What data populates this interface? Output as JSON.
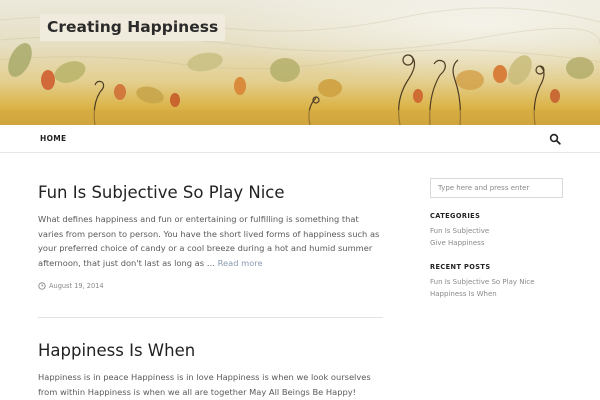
{
  "header": {
    "site_title": "Creating Happiness"
  },
  "nav": {
    "home_label": "HOME",
    "search_icon": "search-icon"
  },
  "posts": [
    {
      "title": "Fun Is Subjective So Play Nice",
      "excerpt": "What defines happiness and fun or entertaining or fulfilling is something that varies from person to person.  You have the short lived forms of happiness such as your preferred choice of candy or a cool breeze during a hot and humid summer afternoon, that just don't last as long as …",
      "read_more": "Read more",
      "date": "August 19, 2014",
      "date_icon": "clock-icon"
    },
    {
      "title": "Happiness Is When",
      "excerpt": "Happiness is in peace Happiness is in love Happiness is when we look ourselves from within Happiness is when we all are together May All Beings Be Happy!"
    }
  ],
  "sidebar": {
    "search_placeholder": "Type here and press enter",
    "categories_title": "CATEGORIES",
    "categories": [
      "Fun Is Subjective",
      "Give Happiness"
    ],
    "recent_title": "RECENT POSTS",
    "recent_posts": [
      "Fun Is Subjective So Play Nice",
      "Happiness Is When"
    ]
  },
  "colors": {
    "link_gray": "#8a8a8a",
    "read_more": "#8a9bb0",
    "banner_gold": "#dcb54a"
  }
}
